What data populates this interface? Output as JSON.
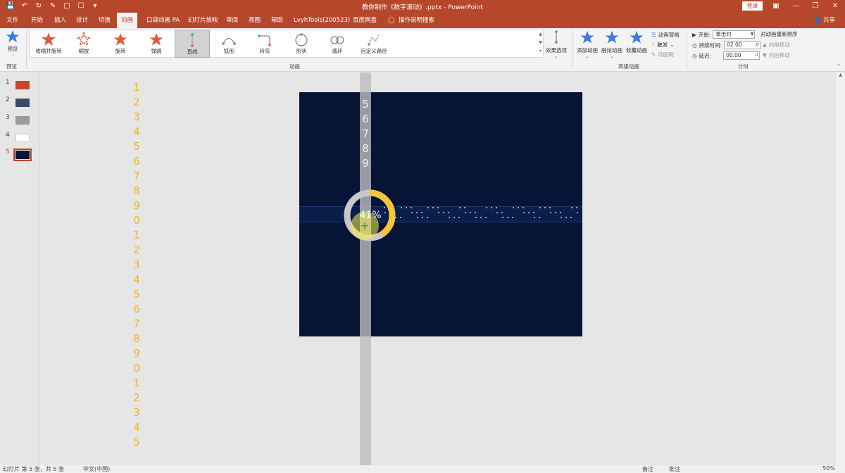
{
  "window": {
    "title": "教你制作《数字滚动》.pptx  -  PowerPoint",
    "login_label": "登录",
    "share_label": "共享"
  },
  "tabs": [
    "文件",
    "开始",
    "插入",
    "设计",
    "切换",
    "动画",
    "口袋动画 PA",
    "幻灯片放映",
    "审阅",
    "视图",
    "帮助",
    "LvyhTools(200523)",
    "百度网盘",
    "操作说明搜索"
  ],
  "active_tab": "动画",
  "ribbon": {
    "preview_label": "预览",
    "preview_group": "预览",
    "animation_group": "动画",
    "effects": [
      "收缩并旋转",
      "缩放",
      "旋转",
      "弹跳",
      "直线",
      "弧形",
      "转弯",
      "形状",
      "循环",
      "自定义路径"
    ],
    "active_effect": "直线",
    "effect_options": "效果选项",
    "add_animation": "添加动画",
    "animation_painter": "动画刷",
    "animation_pane": "动画窗格",
    "trigger": "触发",
    "copy_animation": "收藏动画",
    "advanced_group": "高级动画",
    "start_label": "开始:",
    "start_value": "单击时",
    "duration_label": "持续时间:",
    "duration_value": "02.00",
    "delay_label": "延迟:",
    "delay_value": "00.00",
    "reorder_label": "对动画重新排序",
    "move_earlier": "向前移动",
    "move_later": "向后移动",
    "timing_group": "计时",
    "add_animation_brush": "融炫动画"
  },
  "slides": {
    "numbers": [
      "1",
      "2",
      "3",
      "4",
      "5"
    ],
    "active": "5"
  },
  "workspace": {
    "left_digits": [
      "1",
      "2",
      "3",
      "4",
      "5",
      "6",
      "7",
      "8",
      "9",
      "0",
      "1",
      "2",
      "3",
      "4",
      "5",
      "6",
      "7",
      "8",
      "9",
      "0",
      "1",
      "2",
      "3",
      "4",
      "5"
    ],
    "strip_digits": [
      "5",
      "6",
      "7",
      "8",
      "9"
    ],
    "progress_label": "41%",
    "progress_fraction": 0.41
  },
  "status": {
    "slide_info": "幻灯片 第 5 张，共 5 张",
    "language": "中文(中国)",
    "notes": "备注",
    "comments": "批注",
    "zoom": "50%"
  },
  "colors": {
    "accent": "#b7472a",
    "slide_bg": "#061436",
    "digit_color": "#f2b320",
    "ring_fill": "#f7c53a",
    "ring_bg": "#c8c8c8"
  }
}
